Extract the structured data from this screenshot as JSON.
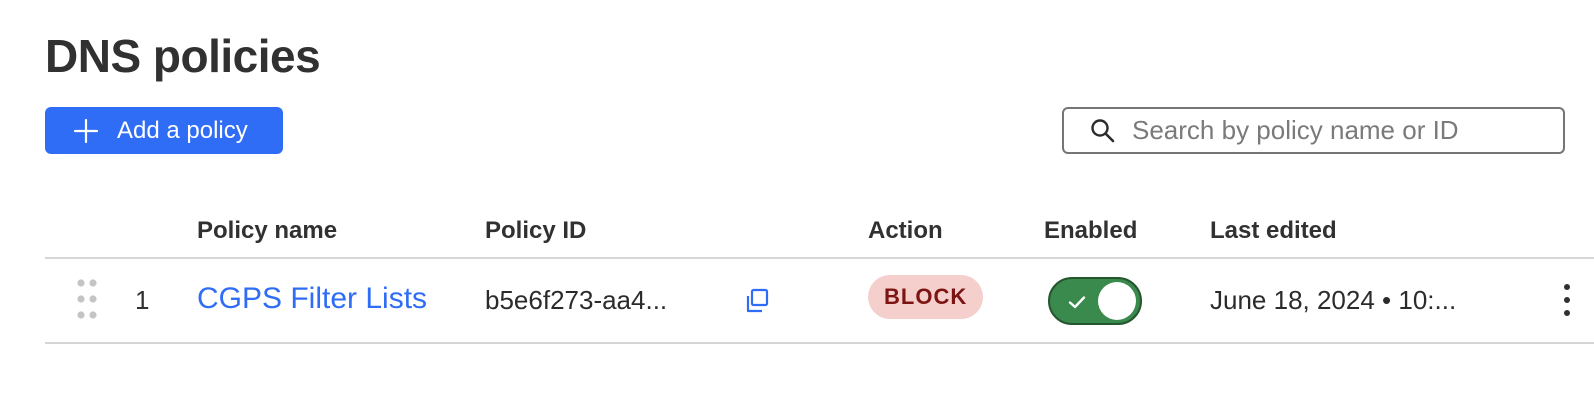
{
  "page": {
    "title": "DNS policies"
  },
  "toolbar": {
    "add_label": "Add a policy",
    "add_icon": "plus-icon",
    "search_placeholder": "Search by policy name or ID",
    "search_value": "",
    "search_icon": "search-icon"
  },
  "table": {
    "columns": [
      "Policy name",
      "Policy ID",
      "Action",
      "Enabled",
      "Last edited"
    ],
    "rows": [
      {
        "index": "1",
        "name": "CGPS Filter Lists",
        "policy_id": "b5e6f273-aa4...",
        "action": "BLOCK",
        "enabled": true,
        "last_edited": "June 18, 2024 • 10:..."
      }
    ]
  },
  "colors": {
    "primary": "#2f6df6",
    "block_badge_bg": "#f5cfcb",
    "block_badge_text": "#7d1414",
    "toggle_on": "#3a8a4d"
  }
}
